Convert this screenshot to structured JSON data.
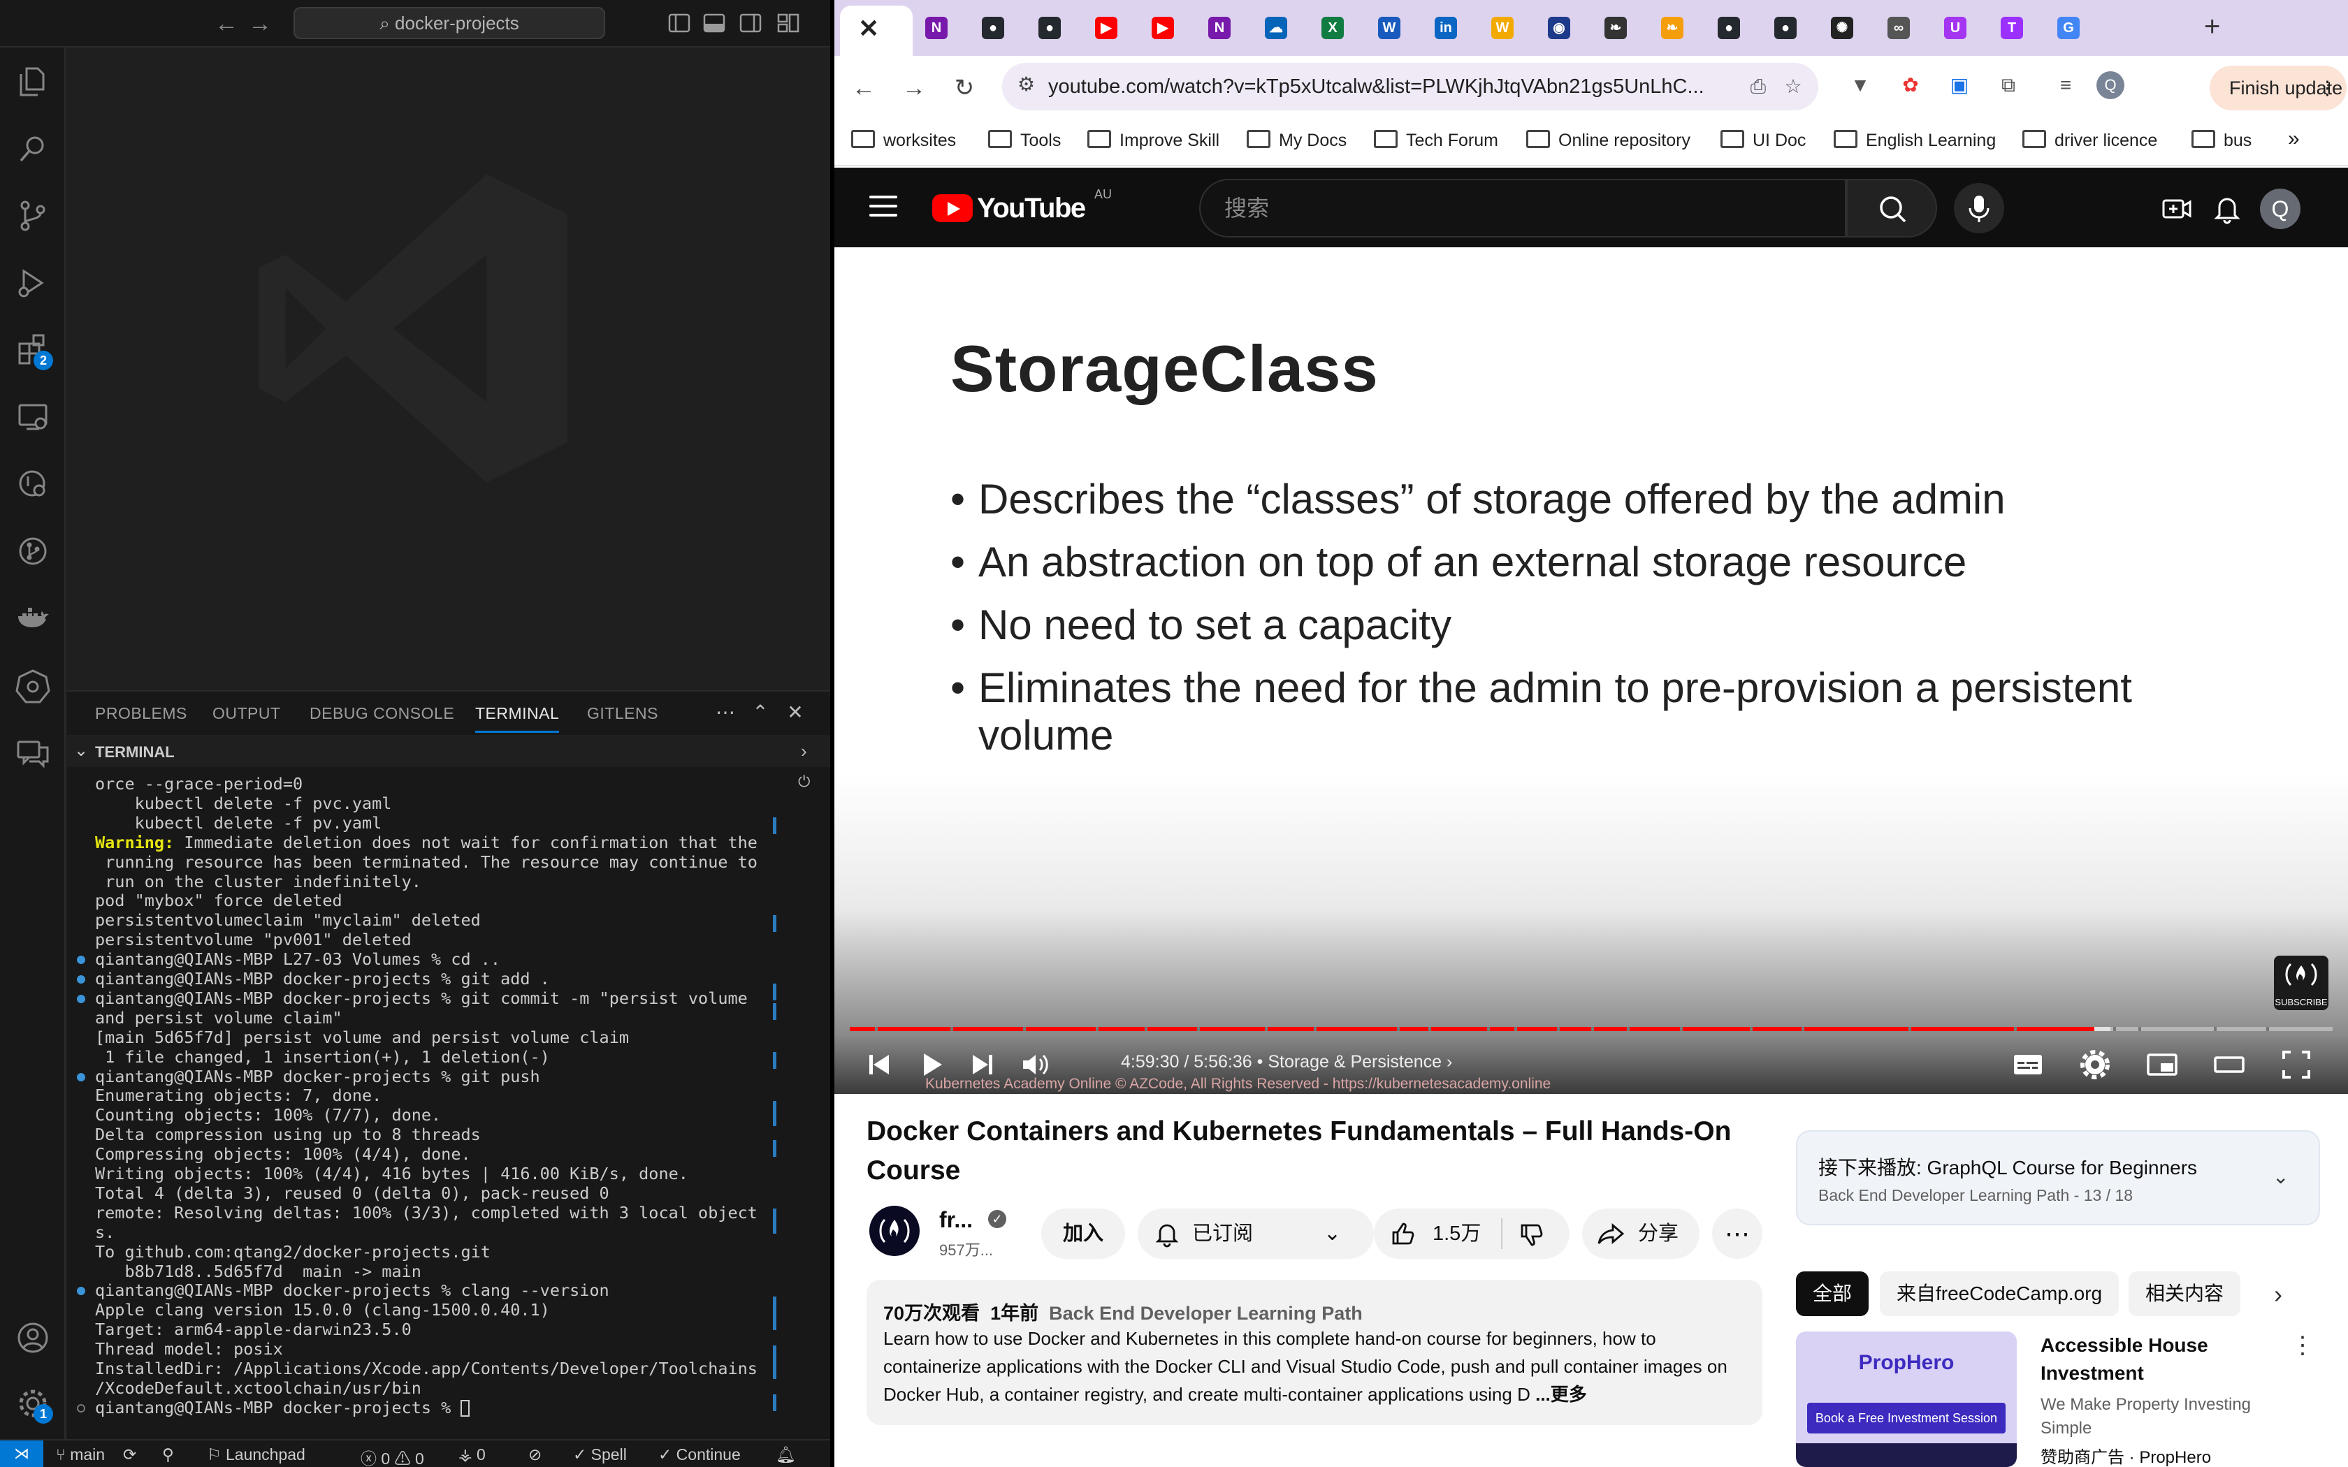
{
  "vscode": {
    "search": "docker-projects",
    "activity_badges": {
      "extensions": "2",
      "accounts": "1"
    },
    "panel_tabs": [
      "PROBLEMS",
      "OUTPUT",
      "DEBUG CONSOLE",
      "TERMINAL",
      "GITLENS"
    ],
    "active_panel_tab": "TERMINAL",
    "terminal_header": "TERMINAL",
    "terminal_lines": [
      "orce --grace-period=0",
      "    kubectl delete -f pvc.yaml",
      "    kubectl delete -f pv.yaml",
      {
        "warn_label": "Warning:",
        "text": " Immediate deletion does not wait for confirmation that the"
      },
      " running resource has been terminated. The resource may continue to",
      " run on the cluster indefinitely.",
      "pod \"mybox\" force deleted",
      "persistentvolumeclaim \"myclaim\" deleted",
      "persistentvolume \"pv001\" deleted",
      "qiantang@QIANs-MBP L27-03 Volumes % cd ..",
      "qiantang@QIANs-MBP docker-projects % git add .",
      "qiantang@QIANs-MBP docker-projects % git commit -m \"persist volume",
      "and persist volume claim\"",
      "[main 5d65f7d] persist volume and persist volume claim",
      " 1 file changed, 1 insertion(+), 1 deletion(-)",
      "qiantang@QIANs-MBP docker-projects % git push",
      "Enumerating objects: 7, done.",
      "Counting objects: 100% (7/7), done.",
      "Delta compression using up to 8 threads",
      "Compressing objects: 100% (4/4), done.",
      "Writing objects: 100% (4/4), 416 bytes | 416.00 KiB/s, done.",
      "Total 4 (delta 3), reused 0 (delta 0), pack-reused 0",
      "remote: Resolving deltas: 100% (3/3), completed with 3 local object",
      "s.",
      "To github.com:qtang2/docker-projects.git",
      "   b8b71d8..5d65f7d  main -> main",
      "qiantang@QIANs-MBP docker-projects % clang --version",
      "Apple clang version 15.0.0 (clang-1500.0.40.1)",
      "Target: arm64-apple-darwin23.5.0",
      "Thread model: posix",
      "InstalledDir: /Applications/Xcode.app/Contents/Developer/Toolchains",
      "/XcodeDefault.xctoolchain/usr/bin",
      "qiantang@QIANs-MBP docker-projects % "
    ],
    "status": {
      "branch": "main",
      "launchpad": "Launchpad",
      "errors": "0",
      "warnings": "0",
      "ports": "0",
      "spell": "Spell",
      "continue": "Continue"
    }
  },
  "chrome": {
    "url": "youtube.com/watch?v=kTp5xUtcalw&list=PLWKjhJtqVAbn21gs5UnLhC...",
    "finish_update": "Finish update",
    "profile_initial": "Q",
    "bookmarks": [
      "worksites",
      "Tools",
      "Improve Skill",
      "My Docs",
      "Tech Forum",
      "Online repository",
      "UI Doc",
      "English Learning",
      "driver licence",
      "bus"
    ],
    "tabs": [
      {
        "icon": "onenote-icon",
        "color": "#7719aa",
        "glyph": "N"
      },
      {
        "icon": "github-icon",
        "color": "#24292f",
        "glyph": "●"
      },
      {
        "icon": "github-icon",
        "color": "#24292f",
        "glyph": "●"
      },
      {
        "icon": "youtube-icon",
        "color": "#ff0000",
        "glyph": "▶"
      },
      {
        "icon": "youtube-icon",
        "color": "#ff0000",
        "glyph": "▶"
      },
      {
        "icon": "onenote-icon",
        "color": "#7719aa",
        "glyph": "N"
      },
      {
        "icon": "onedrive-icon",
        "color": "#0364b8",
        "glyph": "☁"
      },
      {
        "icon": "excel-icon",
        "color": "#107c41",
        "glyph": "X"
      },
      {
        "icon": "word-icon",
        "color": "#185abd",
        "glyph": "W"
      },
      {
        "icon": "linkedin-icon",
        "color": "#0a66c2",
        "glyph": "in"
      },
      {
        "icon": "wordreference-icon",
        "color": "#f2a900",
        "glyph": "W"
      },
      {
        "icon": "globe-icon",
        "color": "#1e3a8a",
        "glyph": "◉"
      },
      {
        "icon": "leaf-icon",
        "color": "#333333",
        "glyph": "❧"
      },
      {
        "icon": "leaf-icon",
        "color": "#f59e0b",
        "glyph": "❧"
      },
      {
        "icon": "github-icon",
        "color": "#24292f",
        "glyph": "●"
      },
      {
        "icon": "github-icon",
        "color": "#24292f",
        "glyph": "●"
      },
      {
        "icon": "chatgpt-icon",
        "color": "#222222",
        "glyph": "✺"
      },
      {
        "icon": "link-icon",
        "color": "#555555",
        "glyph": "∞"
      },
      {
        "icon": "udemy-icon",
        "color": "#a435f0",
        "glyph": "U"
      },
      {
        "icon": "text-icon",
        "color": "#9b30ff",
        "glyph": "T"
      },
      {
        "icon": "google-icon",
        "color": "#4285f4",
        "glyph": "G"
      }
    ]
  },
  "youtube": {
    "region": "AU",
    "logo_text": "YouTube",
    "search_placeholder": "搜索",
    "avatar_initial": "Q",
    "slide": {
      "title": "StorageClass",
      "bullets": [
        "Describes the “classes” of storage offered by the admin",
        "An abstraction on top of an external storage resource",
        "No need to set a capacity",
        "Eliminates the need for the admin to pre-provision a persistent",
        "volume"
      ]
    },
    "player": {
      "time": "4:59:30 / 5:56:36",
      "chapter": "Storage & Persistence",
      "progress_fraction": 0.8395,
      "buffered_fraction": 0.85,
      "watermark": "Kubernetes Academy Online © AZCode, All Rights Reserved - https://kubernetesacademy.online",
      "subscribe_badge": "SUBSCRIBE"
    },
    "video_title": "Docker Containers and Kubernetes Fundamentals – Full Hands-On Course",
    "channel": {
      "name": "fr...",
      "subs": "957万..."
    },
    "buttons": {
      "join": "加入",
      "subscribed": "已订阅",
      "likes": "1.5万",
      "share": "分享"
    },
    "description": {
      "views": "70万次观看",
      "age": "1年前",
      "playlist": "Back End Developer Learning Path",
      "text": "Learn how to use Docker and Kubernetes in this complete hand-on course for beginners, how to containerize applications with the Docker CLI and Visual Studio Code, push and pull container images on Docker Hub, a container registry, and create multi-container applications using D",
      "more": "...更多"
    },
    "up_next": {
      "title": "接下来播放: GraphQL Course for Beginners",
      "sub": "Back End Developer Learning Path - 13 / 18"
    },
    "chips": [
      "全部",
      "来自freeCodeCamp.org",
      "相关内容"
    ],
    "ad": {
      "brand": "PropHero",
      "cta": "Book a Free Investment Session",
      "title": "Accessible House Investment",
      "desc": "We Make Property Investing Simple",
      "sponsor": "赞助商广告 · PropHero"
    }
  }
}
